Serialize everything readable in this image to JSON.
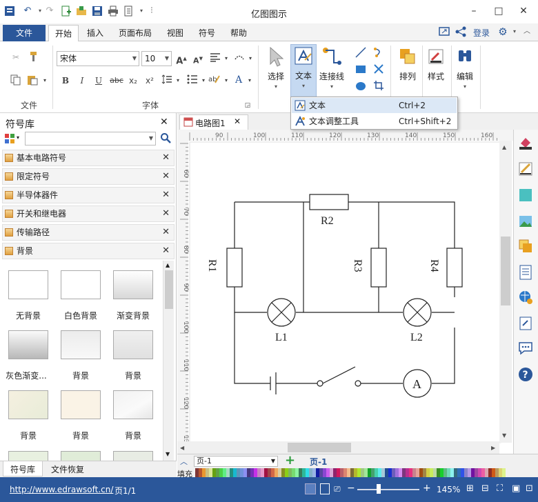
{
  "app": {
    "title": "亿图图示"
  },
  "menu": {
    "file": "文件",
    "tabs": [
      "开始",
      "插入",
      "页面布局",
      "视图",
      "符号",
      "帮助"
    ],
    "login": "登录"
  },
  "ribbon": {
    "font_name": "宋体",
    "font_size": "10",
    "groups": {
      "file": "文件",
      "font": "字体"
    },
    "buttons": {
      "select": "选择",
      "text": "文本",
      "connector": "连接线",
      "arrange": "排列",
      "style": "样式",
      "edit": "编辑"
    },
    "format_glyphs": {
      "bold": "B",
      "italic": "I",
      "underline": "U",
      "strike": "abc",
      "sub": "x₂",
      "sup": "x²",
      "fontcolor": "A"
    }
  },
  "dropdown": [
    {
      "label": "文本",
      "shortcut": "Ctrl+2"
    },
    {
      "label": "文本调整工具",
      "shortcut": "Ctrl+Shift+2"
    }
  ],
  "library": {
    "title": "符号库",
    "items": [
      "基本电路符号",
      "限定符号",
      "半导体器件",
      "开关和继电器",
      "传输路径",
      "背景"
    ],
    "thumbs": [
      "无背景",
      "白色背景",
      "渐变背景",
      "灰色渐变...",
      "背景",
      "背景",
      "背景",
      "背景",
      "背景"
    ]
  },
  "doc": {
    "tab": "电路图1"
  },
  "ruler": {
    "top": [
      "90",
      "100",
      "110",
      "120",
      "130",
      "140",
      "150",
      "160"
    ],
    "left": [
      "60",
      "70",
      "80",
      "90",
      "100",
      "110",
      "120",
      "130"
    ]
  },
  "circuit": {
    "labels": [
      "R2",
      "R1",
      "R3",
      "R4",
      "L1",
      "L2",
      "A"
    ]
  },
  "pages": {
    "current": "页-1",
    "tab": "页-1",
    "fill_label": "填充"
  },
  "bottom_tabs": [
    "符号库",
    "文件恢复"
  ],
  "status": {
    "url": "http://www.edrawsoft.cn/",
    "page": "页1/1",
    "zoom": "145%"
  },
  "colors": {
    "accent": "#2b579a"
  }
}
